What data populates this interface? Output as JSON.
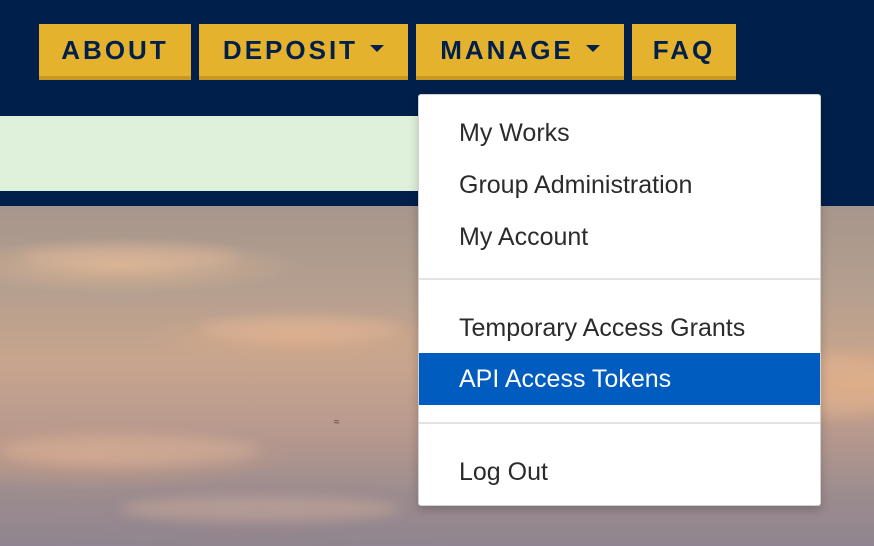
{
  "nav": {
    "about_label": "ABOUT",
    "deposit_label": "DEPOSIT",
    "manage_label": "MANAGE",
    "faq_label": "FAQ"
  },
  "manage_menu": {
    "items": [
      {
        "label": "My Works"
      },
      {
        "label": "Group Administration"
      },
      {
        "label": "My Account"
      },
      {
        "label": "Temporary Access Grants"
      },
      {
        "label": "API Access Tokens",
        "highlighted": true
      },
      {
        "label": "Log Out"
      }
    ]
  },
  "colors": {
    "header_background": "#011f4b",
    "nav_button": "#e5b22e",
    "nav_text": "#011f4b",
    "alert_background": "#dff0db",
    "menu_highlight": "#005cbf"
  }
}
